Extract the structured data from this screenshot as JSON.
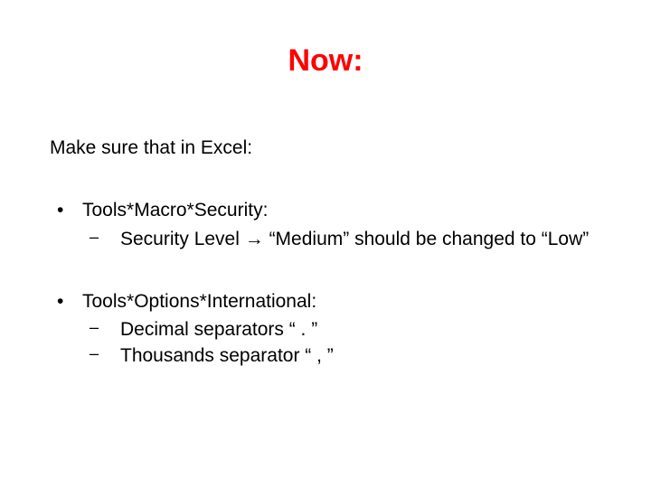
{
  "title": "Now:",
  "intro": "Make sure that in Excel:",
  "bullets": {
    "g1": {
      "head": "Tools*Macro*Security:",
      "sub1": "Security Level → “Medium” should be changed to “Low”"
    },
    "g2": {
      "head": "Tools*Options*International:",
      "sub1": "Decimal separators “ . ”",
      "sub2": "Thousands separator “ , ”"
    }
  }
}
